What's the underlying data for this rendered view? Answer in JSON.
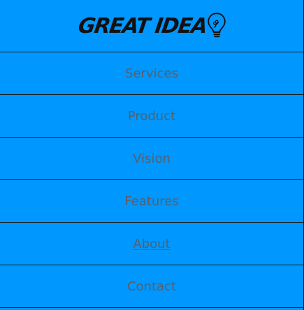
{
  "brand": {
    "logo_text": "GREAT IDEA",
    "icon": "lightbulb-icon"
  },
  "nav": {
    "items": [
      {
        "label": "Services",
        "active": false
      },
      {
        "label": "Product",
        "active": false
      },
      {
        "label": "Vision",
        "active": false
      },
      {
        "label": "Features",
        "active": false
      },
      {
        "label": "About",
        "active": true
      },
      {
        "label": "Contact",
        "active": false
      }
    ]
  },
  "colors": {
    "background": "#0097ff",
    "nav_text": "#56606d",
    "divider": "#1a1a1a",
    "logo": "#111111"
  }
}
